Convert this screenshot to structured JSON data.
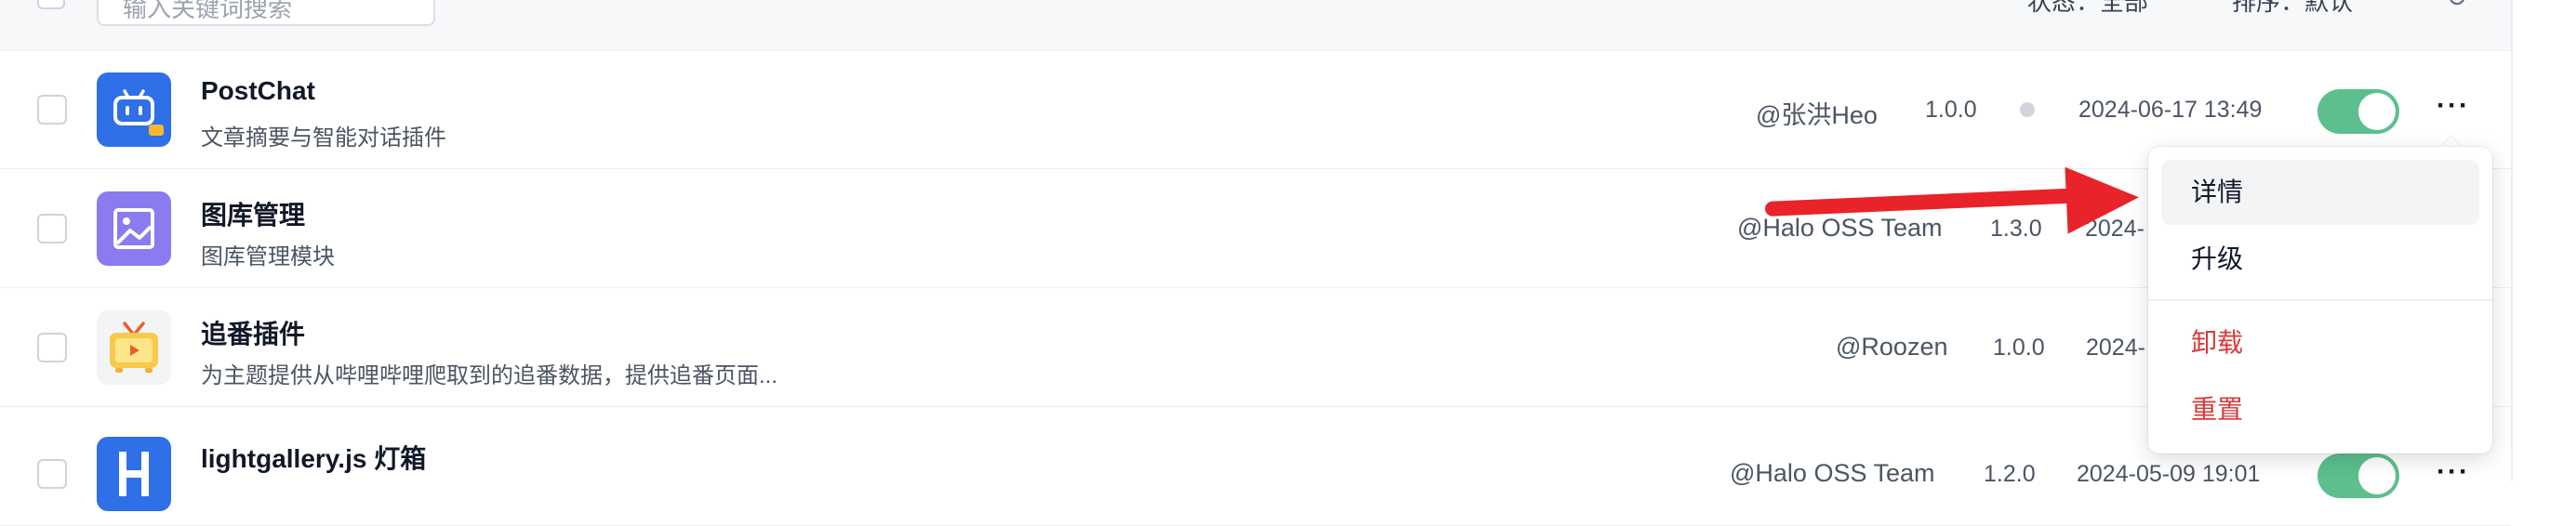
{
  "filter_bar": {
    "search_placeholder": "输入关键词搜索",
    "status_filter": "状态：全部",
    "sort_filter": "排序：默认"
  },
  "plugins": [
    {
      "name": "PostChat",
      "description": "文章摘要与智能对话插件",
      "author": "@张洪Heo",
      "version": "1.0.0",
      "date": "2024-06-17 13:49",
      "icon": "robot-icon",
      "enabled": true
    },
    {
      "name": "图库管理",
      "description": "图库管理模块",
      "author": "@Halo OSS Team",
      "version": "1.3.0",
      "date": "2024-",
      "icon": "image-icon"
    },
    {
      "name": "追番插件",
      "description": "为主题提供从哔哩哔哩爬取到的追番数据，提供追番页面...",
      "author": "@Roozen",
      "version": "1.0.0",
      "date": "2024-",
      "icon": "tv-icon"
    },
    {
      "name": "lightgallery.js 灯箱",
      "description": "",
      "author": "@Halo OSS Team",
      "version": "1.2.0",
      "date": "2024-05-09 19:01",
      "icon": "letter-h-icon",
      "enabled": true
    }
  ],
  "more_label": "···",
  "dropdown": {
    "items": [
      {
        "label": "详情",
        "danger": false,
        "highlighted": true
      },
      {
        "label": "升级",
        "danger": false
      },
      {
        "label": "卸载",
        "danger": true
      },
      {
        "label": "重置",
        "danger": true
      }
    ]
  },
  "colors": {
    "toggle_on": "#5dbf8d",
    "danger": "#d93838",
    "annotation_arrow": "#e8232a"
  }
}
